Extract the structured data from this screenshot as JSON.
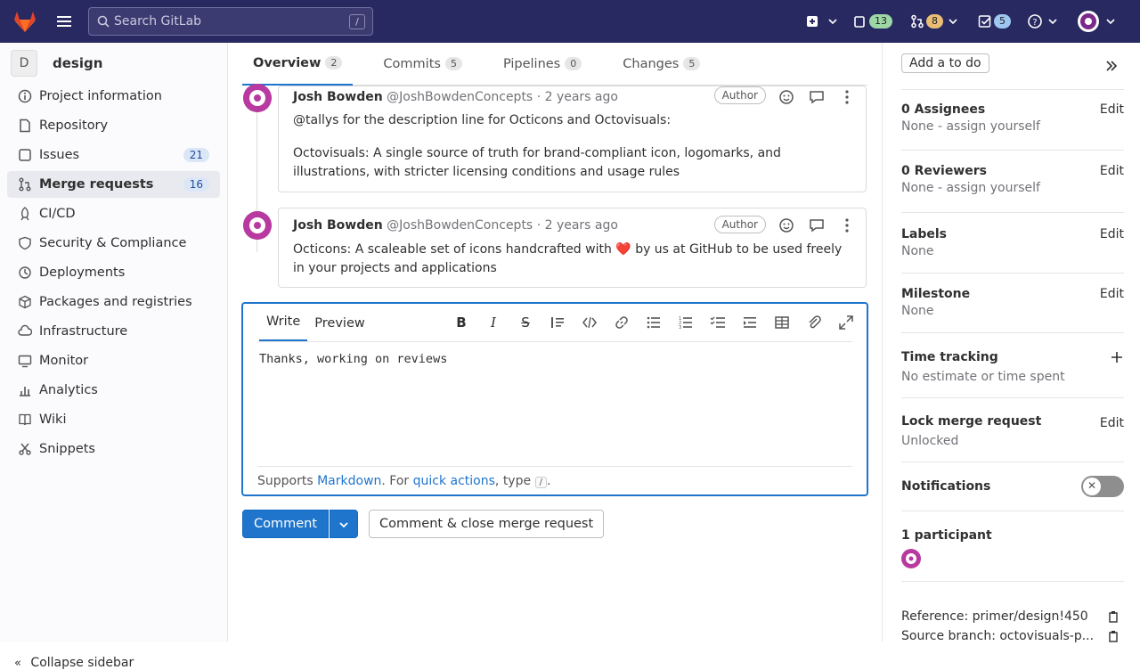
{
  "topbar": {
    "search_placeholder": "Search GitLab",
    "search_shortcut": "/",
    "issues_count": "13",
    "mr_count": "8",
    "todo_count": "5",
    "colors": {
      "bg": "#292961",
      "issues_pill": "#9dd7a6",
      "mr_pill": "#e9be74",
      "todo_pill": "#9dc7f1"
    }
  },
  "sidebar": {
    "project_initial": "D",
    "project_name": "design",
    "items": [
      {
        "label": "Project information",
        "icon": "info-icon"
      },
      {
        "label": "Repository",
        "icon": "doc-icon"
      },
      {
        "label": "Issues",
        "icon": "issues-icon",
        "count": "21"
      },
      {
        "label": "Merge requests",
        "icon": "merge-request-icon",
        "count": "16",
        "active": true
      },
      {
        "label": "CI/CD",
        "icon": "rocket-icon"
      },
      {
        "label": "Security & Compliance",
        "icon": "shield-icon"
      },
      {
        "label": "Deployments",
        "icon": "deployments-icon"
      },
      {
        "label": "Packages and registries",
        "icon": "package-icon"
      },
      {
        "label": "Infrastructure",
        "icon": "cloud-icon"
      },
      {
        "label": "Monitor",
        "icon": "monitor-icon"
      },
      {
        "label": "Analytics",
        "icon": "chart-icon"
      },
      {
        "label": "Wiki",
        "icon": "book-icon"
      },
      {
        "label": "Snippets",
        "icon": "snippet-icon"
      }
    ],
    "collapse_label": "Collapse sidebar"
  },
  "tabs": [
    {
      "label": "Overview",
      "count": "2"
    },
    {
      "label": "Commits",
      "count": "5"
    },
    {
      "label": "Pipelines",
      "count": "0"
    },
    {
      "label": "Changes",
      "count": "5"
    }
  ],
  "notes": [
    {
      "author": "Josh Bowden",
      "handle": "@JoshBowdenConcepts",
      "time": "· 2 years ago",
      "badge": "Author",
      "para1": "@tallys for the description line for Octicons and Octovisuals:",
      "para2": "Octovisuals: A single source of truth for brand-compliant icon, logomarks, and illustrations, with stricter licensing conditions and usage rules"
    },
    {
      "author": "Josh Bowden",
      "handle": "@JoshBowdenConcepts",
      "time": "· 2 years ago",
      "badge": "Author",
      "para1a": "Octicons: A scaleable set of icons handcrafted with",
      "heart": "❤️",
      "para1b": "by us at GitHub to be used freely in your projects and applications"
    }
  ],
  "editor": {
    "tab_write": "Write",
    "tab_preview": "Preview",
    "text": "Thanks, working on reviews",
    "footer_supports": "Supports",
    "footer_markdown": "Markdown",
    "footer_for": ". For",
    "footer_quick": "quick actions",
    "footer_type": ", type",
    "footer_slash": "/",
    "footer_end": "."
  },
  "buttons": {
    "comment": "Comment",
    "close": "Comment & close merge request"
  },
  "right": {
    "add_todo": "Add a to do",
    "assignees_title": "0 Assignees",
    "assignees_value": "None - assign yourself",
    "reviewers_title": "0 Reviewers",
    "reviewers_value": "None - assign yourself",
    "labels_title": "Labels",
    "labels_value": "None",
    "milestone_title": "Milestone",
    "milestone_value": "None",
    "time_title": "Time tracking",
    "time_value": "No estimate or time spent",
    "lock_title": "Lock merge request",
    "lock_value": "Unlocked",
    "notifications_title": "Notifications",
    "participants_title": "1 participant",
    "edit": "Edit",
    "reference": "Reference: primer/design!450",
    "source_branch": "Source branch: octovisuals-p..."
  }
}
